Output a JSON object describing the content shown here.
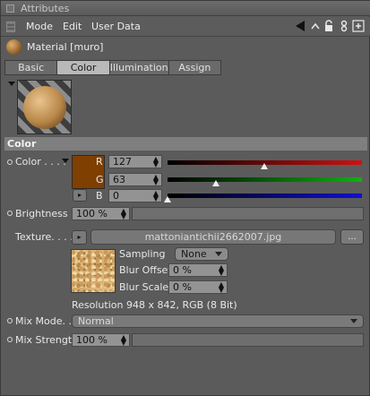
{
  "window": {
    "title": "Attributes"
  },
  "menu": {
    "items": [
      "Mode",
      "Edit",
      "User Data"
    ]
  },
  "material": {
    "title": "Material [muro]"
  },
  "tabs": [
    {
      "label": "Basic",
      "active": false
    },
    {
      "label": "Color",
      "active": true
    },
    {
      "label": "Illumination",
      "active": false
    },
    {
      "label": "Assign",
      "active": false
    }
  ],
  "section": {
    "title": "Color"
  },
  "color": {
    "label": "Color . . . .",
    "swatch_hex": "#7f3f00",
    "r": {
      "label": "R",
      "value": "127",
      "level": 0.498
    },
    "g": {
      "label": "G",
      "value": "63",
      "level": 0.247
    },
    "b": {
      "label": "B",
      "value": "0",
      "level": 0.0
    }
  },
  "brightness": {
    "label": "Brightness",
    "value": "100 %"
  },
  "texture": {
    "label": "Texture. . . .",
    "filename": "mattoniantichii2662007.jpg",
    "more_label": "...",
    "sampling_label": "Sampling",
    "sampling_value": "None",
    "blur_offset_label": "Blur Offset",
    "blur_offset_value": "0 %",
    "blur_scale_label": "Blur Scale",
    "blur_scale_value": "0 %",
    "resolution": "Resolution 948 x 842, RGB (8 Bit)"
  },
  "mix_mode": {
    "label": "Mix Mode. . .",
    "value": "Normal"
  },
  "mix_strength": {
    "label": "Mix Strength",
    "value": "100 %"
  },
  "colors": {
    "accent_red": "#cc1111",
    "accent_green": "#11aa11",
    "accent_blue": "#1111cc"
  }
}
